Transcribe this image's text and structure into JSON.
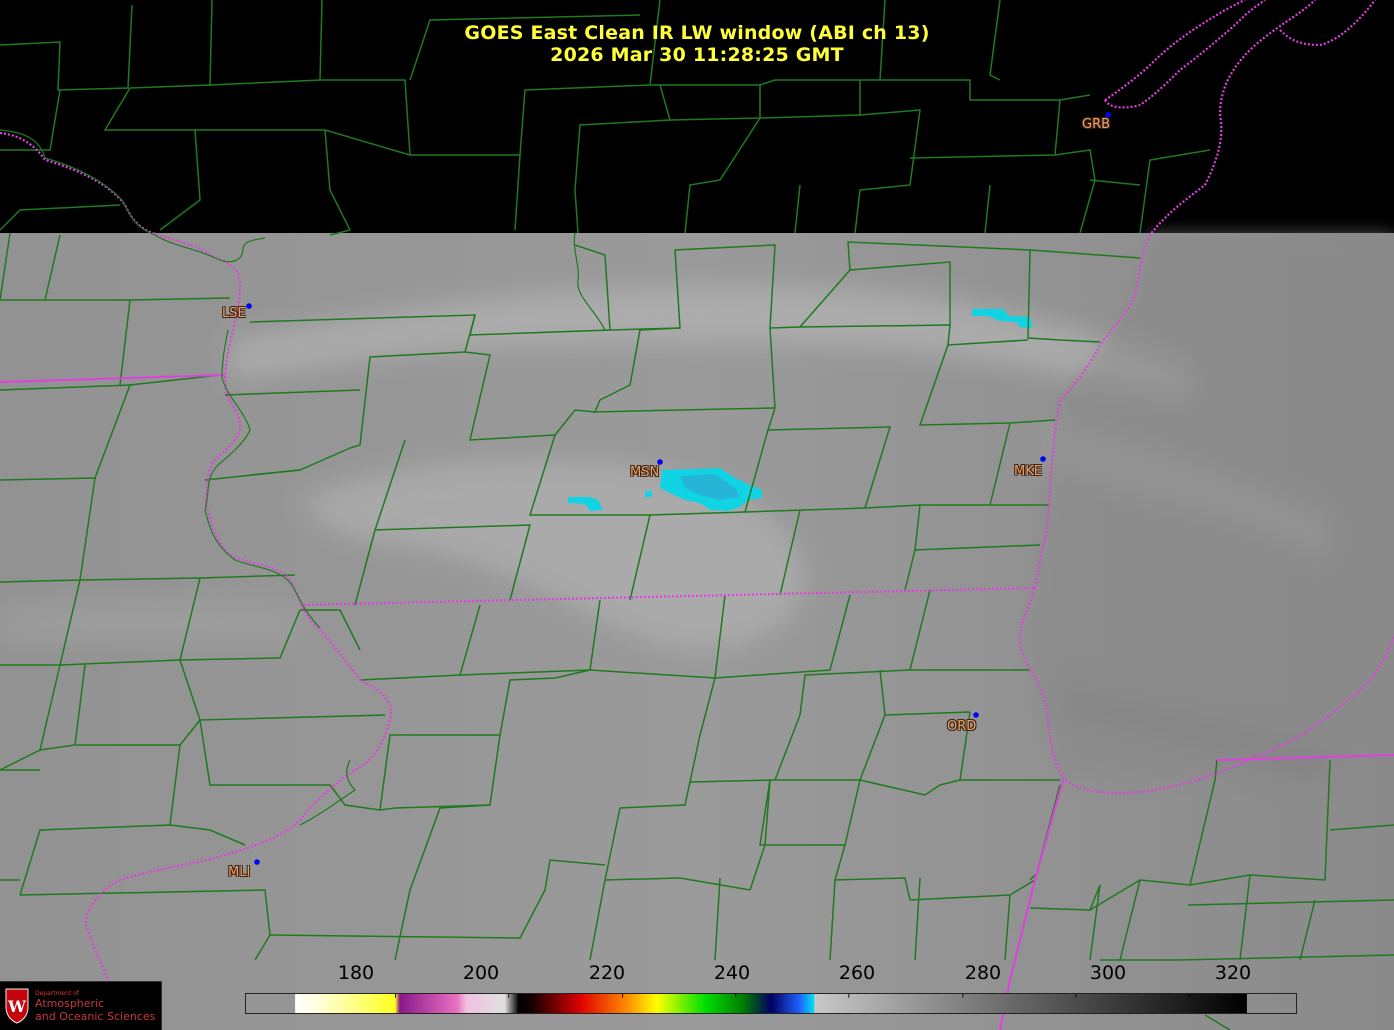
{
  "title": {
    "line1": "GOES East Clean IR LW window (ABI ch 13)",
    "line2": "2026 Mar 30  11:28:25 GMT"
  },
  "stations": [
    {
      "id": "GRB",
      "label": "GRB"
    },
    {
      "id": "LSE",
      "label": "LSE"
    },
    {
      "id": "MSN",
      "label": "MSN"
    },
    {
      "id": "MKE",
      "label": "MKE"
    },
    {
      "id": "ORD",
      "label": "ORD"
    },
    {
      "id": "MLI",
      "label": "MLI"
    }
  ],
  "colorbar": {
    "ticks": [
      "180",
      "200",
      "220",
      "240",
      "260",
      "280",
      "300",
      "320"
    ]
  },
  "logo": {
    "department": "Department of",
    "line1": "Atmospheric",
    "line2": "and Oceanic Sciences"
  },
  "colors": {
    "title": "#ffff3a",
    "county_lines": "#1f7a1f",
    "state_lines": "#e040e0",
    "station_label": "#f0a060",
    "station_dot": "#0000ff",
    "cold_cloud": "#10d0e0",
    "land_gray": "#8e8e8e"
  }
}
